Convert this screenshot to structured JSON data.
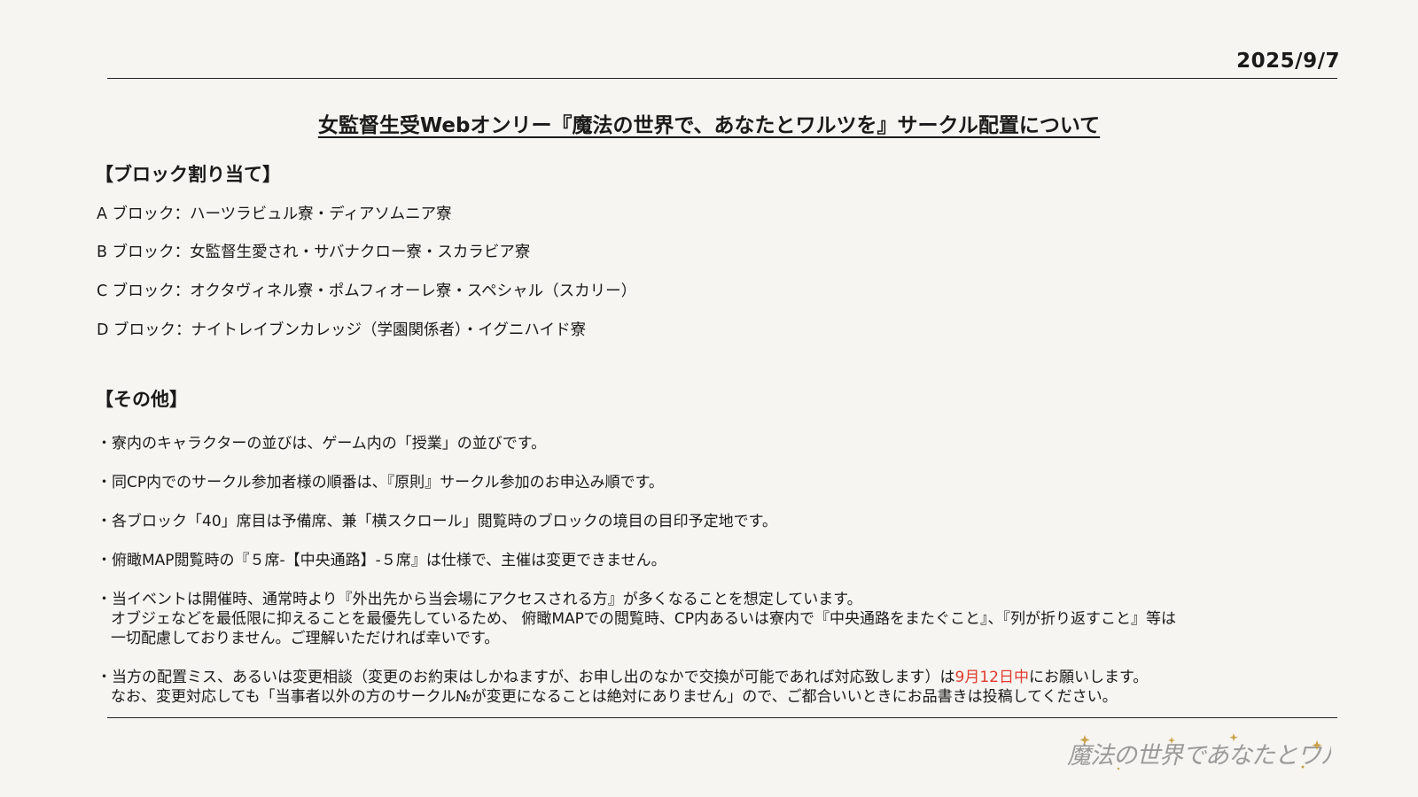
{
  "date": "2025/9/7",
  "title": "女監督生受Webオンリー『魔法の世界で、あなたとワルツを』サークル配置について",
  "blocks": {
    "heading": "【ブロック割り当て】",
    "items": [
      "A ブロック：ハーツラビュル寮・ディアソムニア寮",
      "B ブロック：女監督生愛され・サバナクロー寮・スカラビア寮",
      "C ブロック：オクタヴィネル寮・ポムフィオーレ寮・スペシャル（スカリー）",
      "D ブロック：ナイトレイブンカレッジ（学園関係者）・イグニハイド寮"
    ]
  },
  "other": {
    "heading": "【その他】",
    "note1": "・寮内のキャラクターの並びは、ゲーム内の「授業」の並びです。",
    "note2": "・同CP内でのサークル参加者様の順番は、『原則』サークル参加のお申込み順です。",
    "note3": "・各ブロック「40」席目は予備席、兼「横スクロール」閲覧時のブロックの境目の目印予定地です。",
    "note4": "・俯瞰MAP閲覧時の『５席-【中央通路】-５席』は仕様で、主催は変更できません。",
    "note5_line1": "・当イベントは開催時、通常時より『外出先から当会場にアクセスされる方』が多くなることを想定しています。",
    "note5_line2": "オブジェなどを最低限に抑えることを最優先しているため、 俯瞰MAPでの閲覧時、CP内あるいは寮内で『中央通路をまたぐこと』、『列が折り返すこと』等は",
    "note5_line3": "一切配慮しておりません。ご理解いただければ幸いです。",
    "note6_line1_a": "・当方の配置ミス、あるいは変更相談（変更のお約束はしかねますが、お申し出のなかで交換が可能であれば対応致します）は",
    "note6_line1_red": "9月12日中",
    "note6_line1_b": "にお願いします。",
    "note6_line2": "なお、変更対応しても「当事者以外の方のサークル№が変更になることは絶対にありません」ので、ご都合いいときにお品書きは投稿してください。"
  },
  "logo_text": "魔法の世界であなたとワルツを",
  "colors": {
    "background": "#f7f5f1",
    "accent_red": "#e03a2f",
    "logo_gold": "#b58a3a"
  }
}
